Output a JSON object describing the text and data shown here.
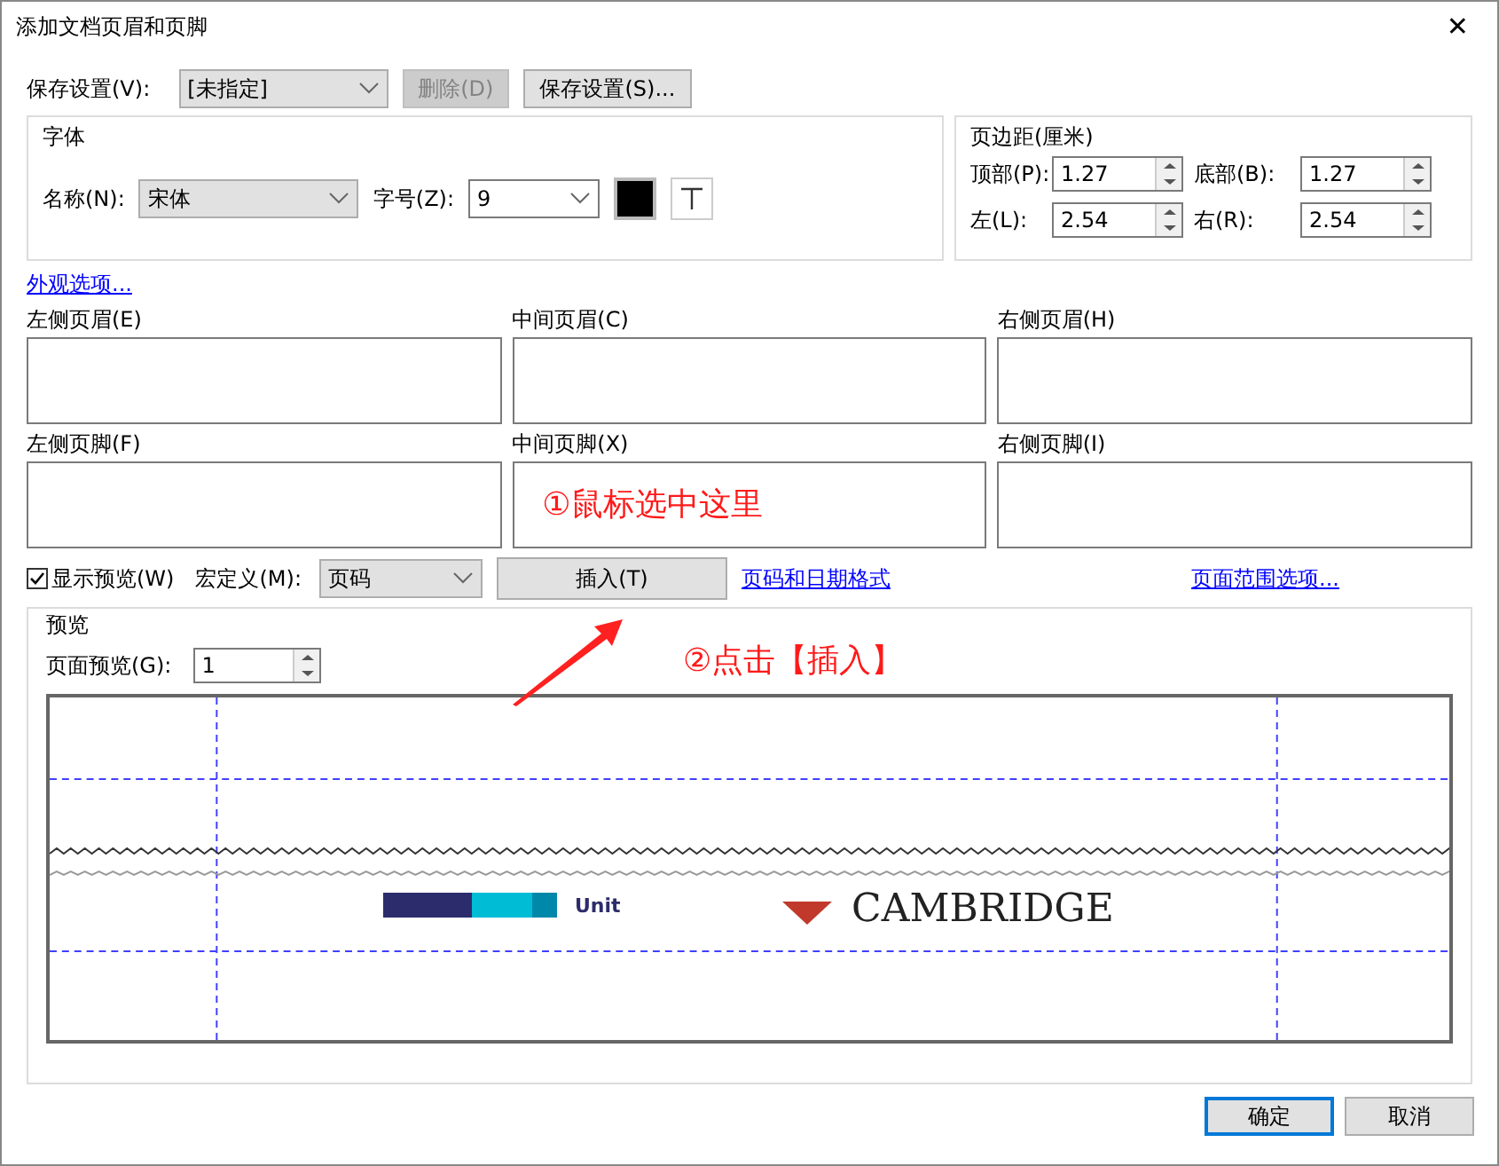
{
  "window": {
    "title": "添加文档页眉和页脚",
    "close": "✕"
  },
  "saved_settings": {
    "label": "保存设置(V):",
    "value": "[未指定]"
  },
  "toolbar_buttons": [
    {
      "label": "删除(D)",
      "disabled": true
    },
    {
      "label": "保存设置(S)...",
      "disabled": false
    }
  ],
  "font": {
    "title": "字体",
    "name_label": "名称(N):",
    "name_value": "宋体",
    "size_label": "字号(Z):",
    "size_value": "9"
  },
  "margins": {
    "title": "页边距(厘米)",
    "fields": [
      {
        "label": "顶部(P):",
        "value": "1.27"
      },
      {
        "label": "底部(B):",
        "value": "1.27"
      },
      {
        "label": "左(L):",
        "value": "2.54"
      },
      {
        "label": "右(R):",
        "value": "2.54"
      }
    ]
  },
  "appearance_link": "外观选项...",
  "header_boxes": [
    {
      "label": "左侧页眉(E)"
    },
    {
      "label": "中间页眉(C)"
    },
    {
      "label": "右侧页眉(H)"
    }
  ],
  "footer_boxes": [
    {
      "label": "左侧页脚(F)"
    },
    {
      "label": "中间页脚(X)",
      "annotation": "①鼠标选中这里"
    },
    {
      "label": "右侧页脚(I)"
    }
  ],
  "show_preview": {
    "label": "显示预览(W)",
    "checked": true
  },
  "macro": {
    "label": "宏定义(M):",
    "value": "页码"
  },
  "insert_button": "插入(T)",
  "insert_annotation": "②点击【插入】",
  "date_format_link": "页码和日期格式",
  "page_range_link": "页面范围选项...",
  "preview": {
    "title": "预览",
    "page_label": "页面预览(G):",
    "page_value": "1",
    "logo_text": "Unit",
    "brand_text": "CAMBRIDGE"
  },
  "buttons": [
    {
      "label": "确定",
      "selected": true
    },
    {
      "label": "取消",
      "selected": false
    }
  ]
}
